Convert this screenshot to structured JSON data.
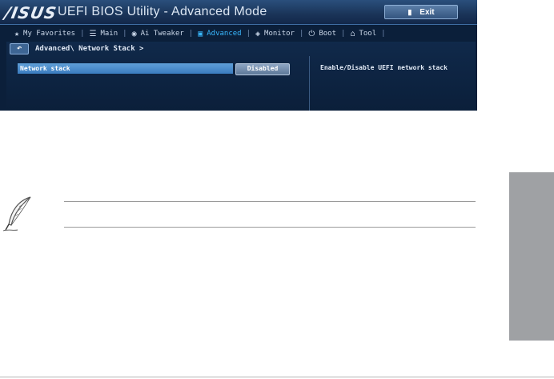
{
  "bios": {
    "logo": "/ISUS",
    "title": "UEFI BIOS Utility - Advanced Mode",
    "exit_label": "Exit",
    "nav": [
      {
        "icon": "★",
        "label": "My Favorites",
        "active": false
      },
      {
        "icon": "☰",
        "label": "Main",
        "active": false
      },
      {
        "icon": "◉",
        "label": "Ai Tweaker",
        "active": false
      },
      {
        "icon": "▣",
        "label": "Advanced",
        "active": true
      },
      {
        "icon": "◈",
        "label": "Monitor",
        "active": false
      },
      {
        "icon": "⏻",
        "label": "Boot",
        "active": false
      },
      {
        "icon": "⌂",
        "label": "Tool",
        "active": false
      }
    ],
    "breadcrumb": "Advanced\\ Network Stack >",
    "option": {
      "label": "Network stack",
      "value": "Disabled"
    },
    "help": "Enable/Disable UEFI network stack"
  },
  "colors": {
    "accent": "#39b8ff",
    "bios_bg": "#0b1f3a",
    "side_tab": "#9fa1a4"
  }
}
